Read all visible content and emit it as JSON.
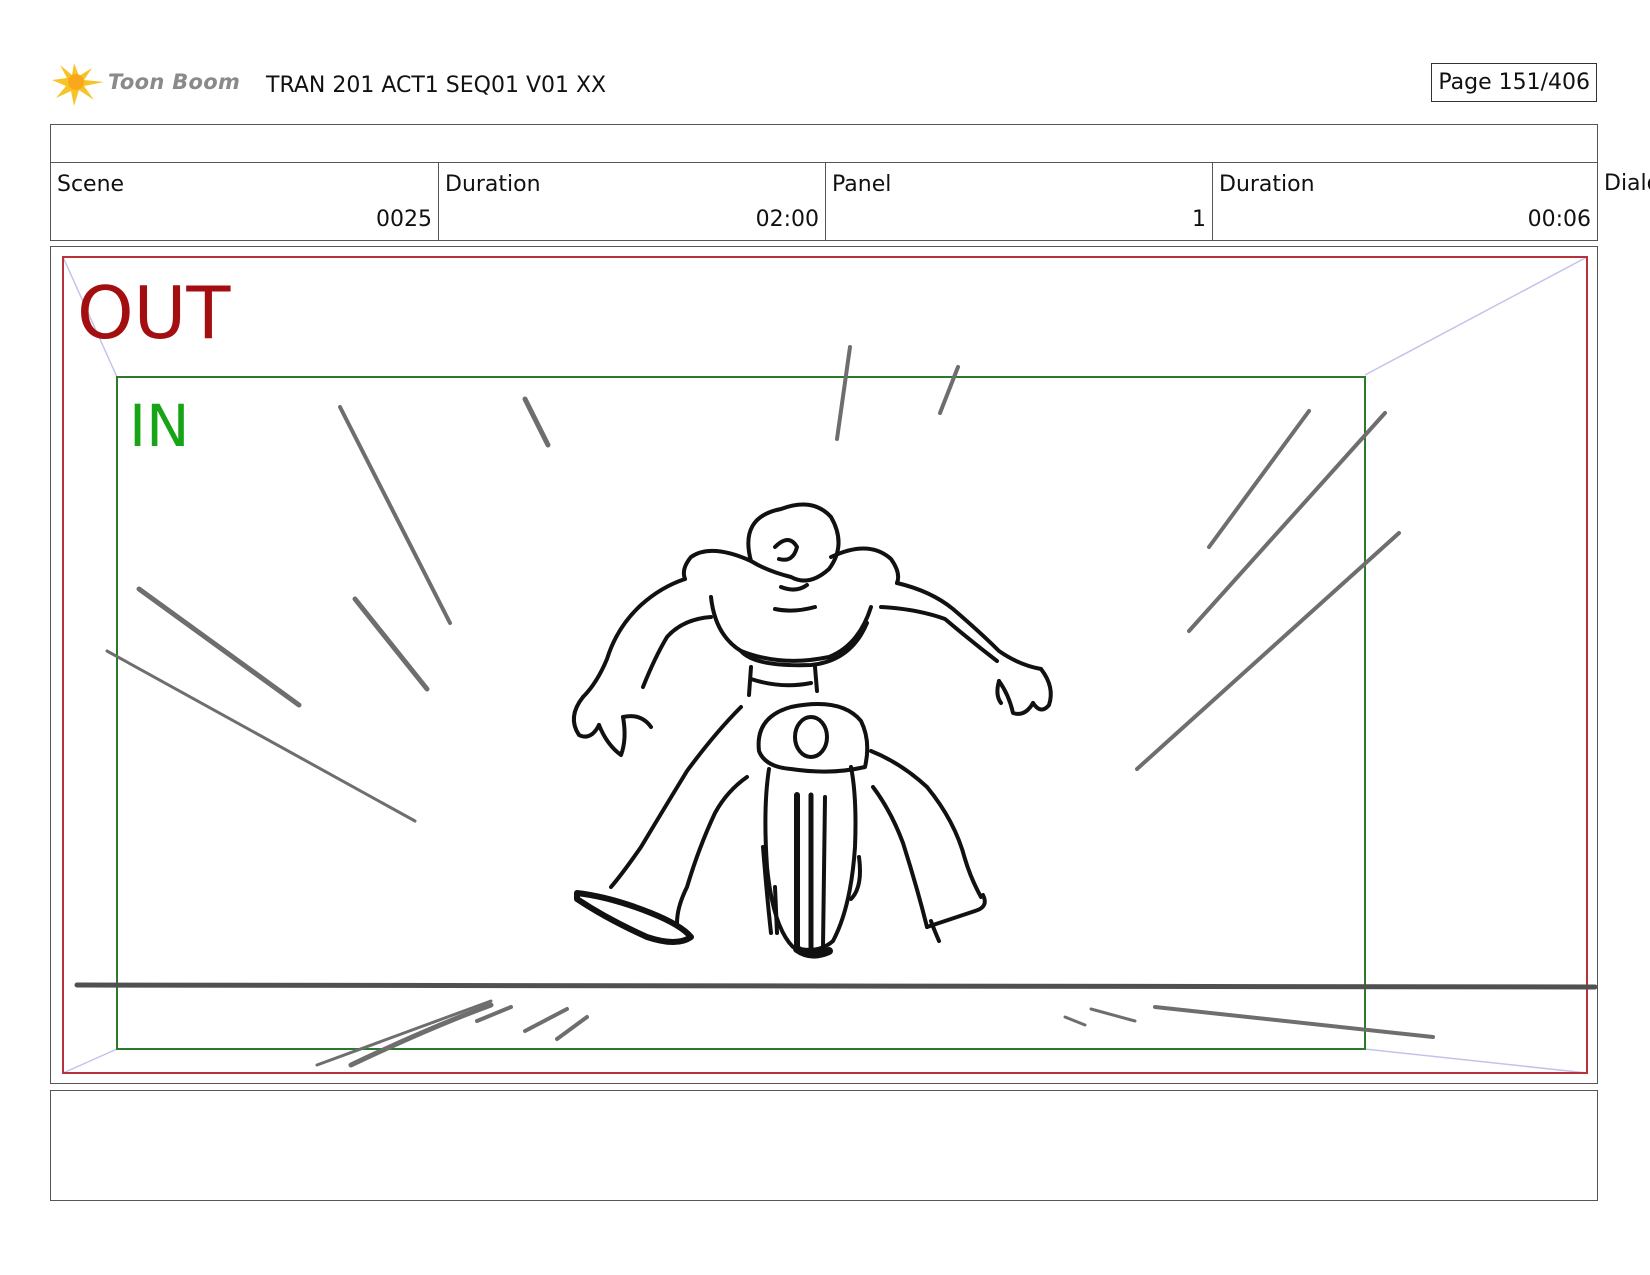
{
  "header": {
    "logo_text": "Toon Boom",
    "logo_icon": "sunburst-logo-icon",
    "doc_title": "TRAN 201 ACT1 SEQ01 V01 XX",
    "page_label": "Page 151/406"
  },
  "info": {
    "scene_label": "Scene",
    "scene_value": "0025",
    "scene_duration_label": "Duration",
    "scene_duration_value": "02:00",
    "panel_label": "Panel",
    "panel_value": "1",
    "panel_duration_label": "Duration",
    "panel_duration_value": "00:06",
    "dialog_label": "Dialo"
  },
  "frame": {
    "out_label": "OUT",
    "in_label": "IN",
    "out_color": "#a30f10",
    "in_color": "#17a517"
  },
  "sketch": {
    "subject": "muscular figure on a motorcycle riding straight toward camera with speed lines"
  }
}
